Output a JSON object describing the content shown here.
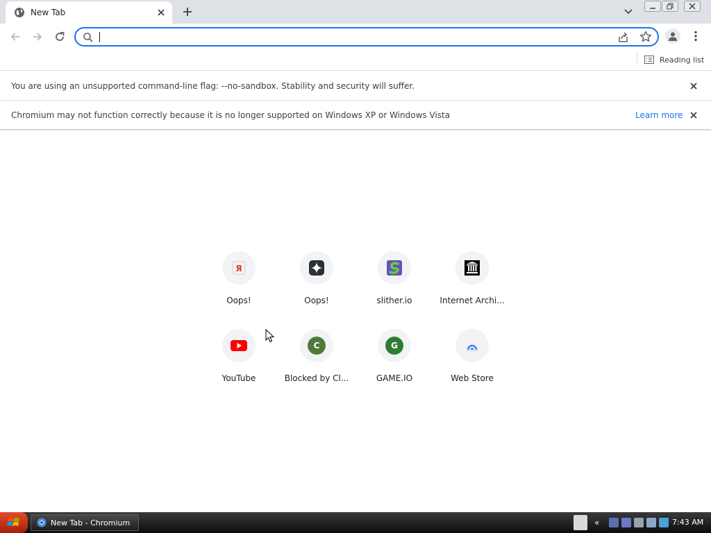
{
  "tab": {
    "title": "New Tab"
  },
  "omnibox": {
    "value": "",
    "placeholder": ""
  },
  "bookmarks_bar": {
    "reading_list": "Reading list"
  },
  "infobars": [
    {
      "message": "You are using an unsupported command-line flag: --no-sandbox. Stability and security will suffer."
    },
    {
      "message": "Chromium may not function correctly because it is no longer supported on Windows XP or Windows Vista",
      "link": "Learn more"
    }
  ],
  "shortcuts": [
    {
      "label": "Oops!",
      "icon": "yandex-icon"
    },
    {
      "label": "Oops!",
      "icon": "sparkle-icon"
    },
    {
      "label": "slither.io",
      "icon": "slither-icon"
    },
    {
      "label": "Internet Archi...",
      "icon": "archive-icon"
    },
    {
      "label": "YouTube",
      "icon": "youtube-icon"
    },
    {
      "label": "Blocked by Cl...",
      "icon": "letter-c-icon",
      "letter": "C"
    },
    {
      "label": "GAME.IO",
      "icon": "letter-g-icon",
      "letter": "G"
    },
    {
      "label": "Web Store",
      "icon": "web-store-icon"
    }
  ],
  "taskbar": {
    "task_label": "New Tab - Chromium",
    "tray_chevron": "«",
    "clock": "7:43 AM"
  },
  "colors": {
    "accent": "#1a73e8",
    "tabstrip": "#dee1e6",
    "letter_tile": "#3f7a3a",
    "youtube": "#ff0000"
  }
}
